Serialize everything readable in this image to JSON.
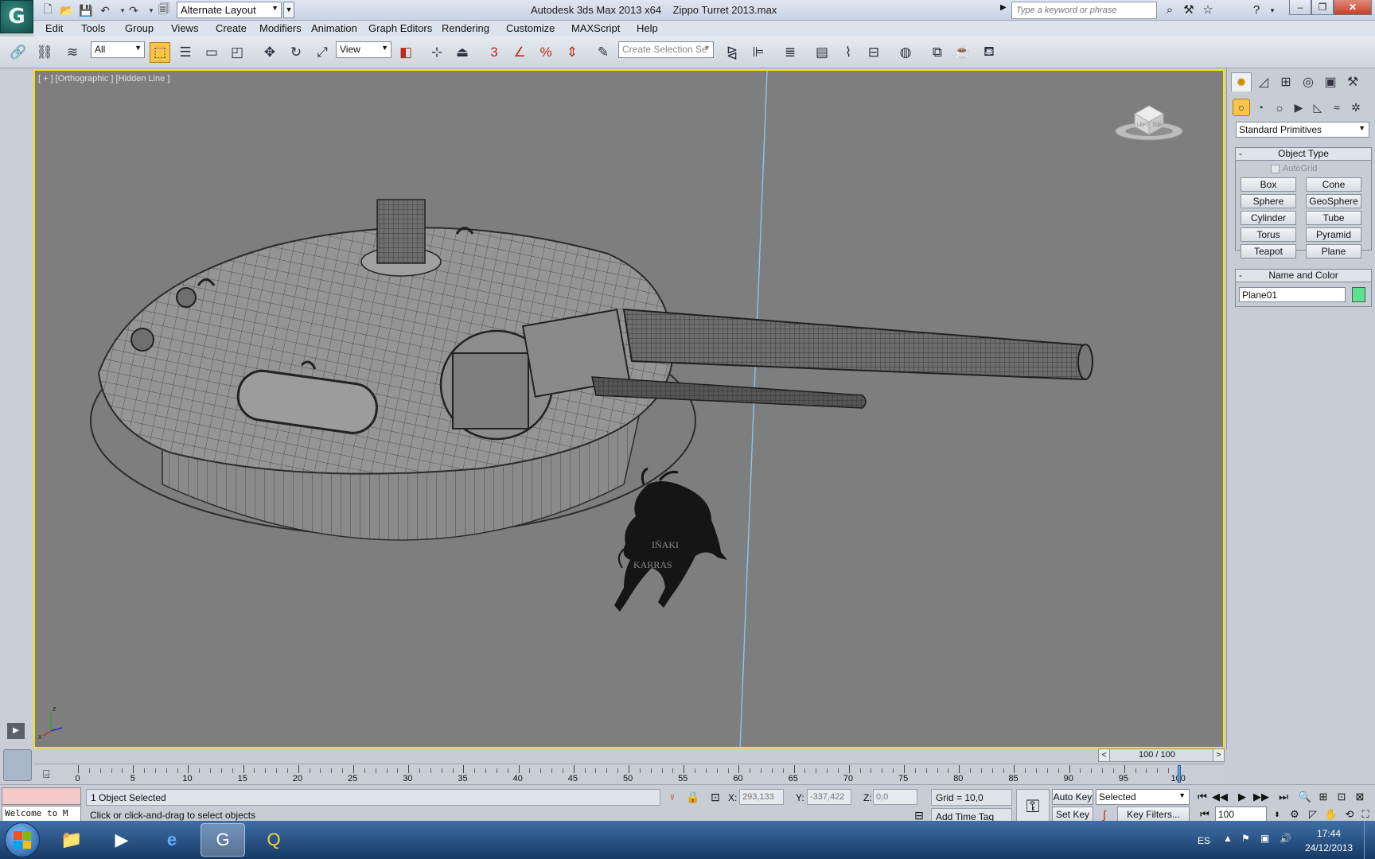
{
  "titlebar": {
    "layout": "Alternate Layout",
    "app_title": "Autodesk 3ds Max  2013 x64",
    "file_name": "Zippo Turret 2013.max",
    "search_placeholder": "Type a keyword or phrase"
  },
  "menu": [
    "Edit",
    "Tools",
    "Group",
    "Views",
    "Create",
    "Modifiers",
    "Animation",
    "Graph Editors",
    "Rendering",
    "Customize",
    "MAXScript",
    "Help"
  ],
  "toolbar": {
    "selection_filter": "All",
    "ref_coord": "View",
    "named_selection_placeholder": "Create Selection Se",
    "snap_label": "3"
  },
  "viewport": {
    "label": "[ + ] [Orthographic ] [Hidden Line ]",
    "watermark_line1": "IÑAKI",
    "watermark_line2": "KARRAS",
    "axis_x": "x",
    "axis_z": "z",
    "viewcube_labels": [
      "TOP",
      "LEFT"
    ]
  },
  "command_panel": {
    "category": "Standard Primitives",
    "object_type": {
      "title": "Object Type",
      "autogrid": "AutoGrid",
      "buttons": [
        "Box",
        "Cone",
        "Sphere",
        "GeoSphere",
        "Cylinder",
        "Tube",
        "Torus",
        "Pyramid",
        "Teapot",
        "Plane"
      ]
    },
    "name_color": {
      "title": "Name and Color",
      "name": "Plane01",
      "color": "#5ae28f"
    }
  },
  "timeline": {
    "slider": "100 / 100",
    "current_frame": 100,
    "ticks": [
      "0",
      "5",
      "10",
      "15",
      "20",
      "25",
      "30",
      "35",
      "40",
      "45",
      "50",
      "55",
      "60",
      "65",
      "70",
      "75",
      "80",
      "85",
      "90",
      "95",
      "100"
    ]
  },
  "status": {
    "listener_output": "Welcome to M",
    "selection": "1 Object Selected",
    "prompt": "Click or click-and-drag to select objects",
    "x_label": "X:",
    "x_value": "293,133",
    "y_label": "Y:",
    "y_value": "-337,422",
    "z_label": "Z:",
    "z_value": "0,0",
    "grid": "Grid = 10,0",
    "add_time_tag": "Add Time Tag",
    "auto_key": "Auto Key",
    "set_key": "Set Key",
    "key_mode": "Selected",
    "key_filters": "Key Filters...",
    "frame": "100"
  },
  "taskbar": {
    "language": "ES",
    "time": "17:44",
    "date": "24/12/2013"
  }
}
